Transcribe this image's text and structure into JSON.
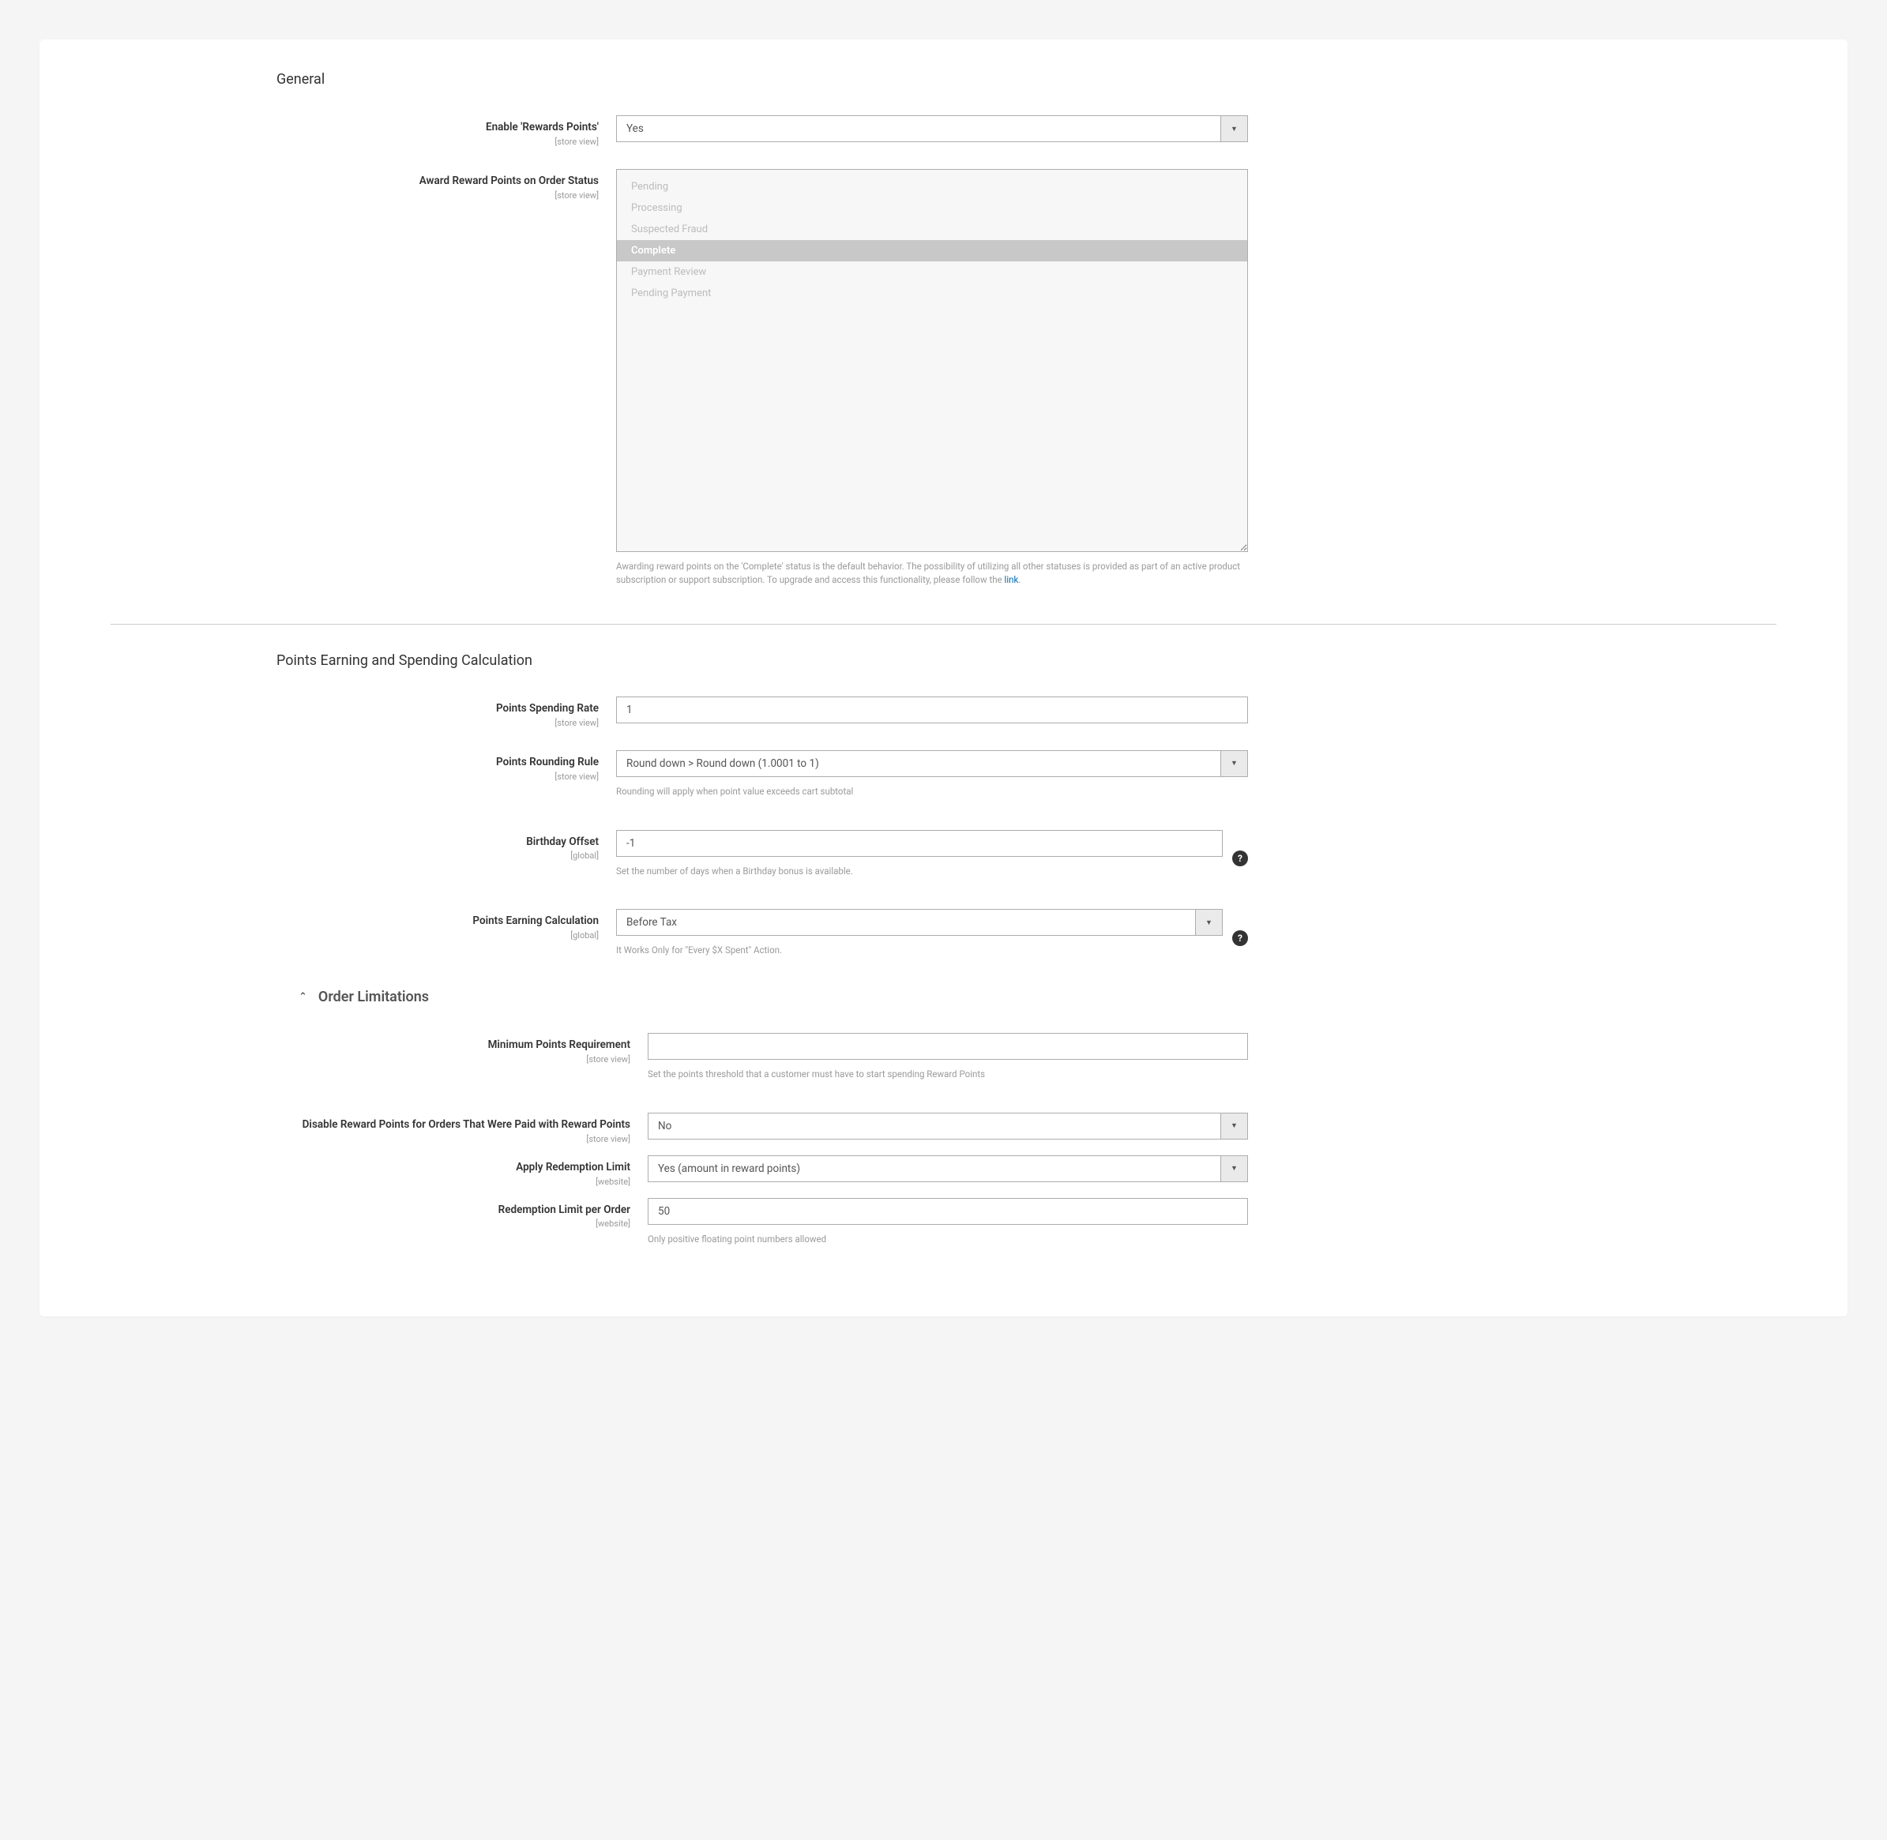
{
  "sections": {
    "general": {
      "title": "General"
    },
    "calc": {
      "title": "Points Earning and Spending Calculation"
    },
    "order_limits": {
      "title": "Order Limitations"
    }
  },
  "scopes": {
    "store_view": "[store view]",
    "global": "[global]",
    "website": "[website]"
  },
  "fields": {
    "enable_rewards": {
      "label": "Enable 'Rewards Points'",
      "value": "Yes"
    },
    "award_on_status": {
      "label": "Award Reward Points on Order Status",
      "options": [
        {
          "label": "Pending",
          "selected": false
        },
        {
          "label": "Processing",
          "selected": false
        },
        {
          "label": "Suspected Fraud",
          "selected": false
        },
        {
          "label": "Complete",
          "selected": true
        },
        {
          "label": "Payment Review",
          "selected": false
        },
        {
          "label": "Pending Payment",
          "selected": false
        }
      ],
      "note_prefix": "Awarding reward points on the 'Complete' status is the default behavior. The possibility of utilizing all other statuses is provided as part of an active product subscription or support subscription. To upgrade and access this functionality, please follow the ",
      "note_link_text": "link",
      "note_suffix": "."
    },
    "spending_rate": {
      "label": "Points Spending Rate",
      "value": "1"
    },
    "rounding_rule": {
      "label": "Points Rounding Rule",
      "value": "Round down > Round down (1.0001 to 1)",
      "note": "Rounding will apply when point value exceeds cart subtotal"
    },
    "birthday_offset": {
      "label": "Birthday Offset",
      "value": "-1",
      "note": "Set the number of days when a Birthday bonus is available."
    },
    "earning_calc": {
      "label": "Points Earning Calculation",
      "value": "Before Tax",
      "note": "It Works Only for \"Every $X Spent\" Action."
    },
    "min_points_req": {
      "label": "Minimum Points Requirement",
      "value": "",
      "note": "Set the points threshold that a customer must have to start spending Reward Points"
    },
    "disable_for_paid_with_points": {
      "label": "Disable Reward Points for Orders That Were Paid with Reward Points",
      "value": "No"
    },
    "apply_redemption_limit": {
      "label": "Apply Redemption Limit",
      "value": "Yes (amount in reward points)"
    },
    "redemption_limit_per_order": {
      "label": "Redemption Limit per Order",
      "value": "50",
      "note": "Only positive floating point numbers allowed"
    }
  },
  "icons": {
    "dropdown_arrow": "▼",
    "chevron_up": "⌃",
    "tooltip": "?"
  }
}
